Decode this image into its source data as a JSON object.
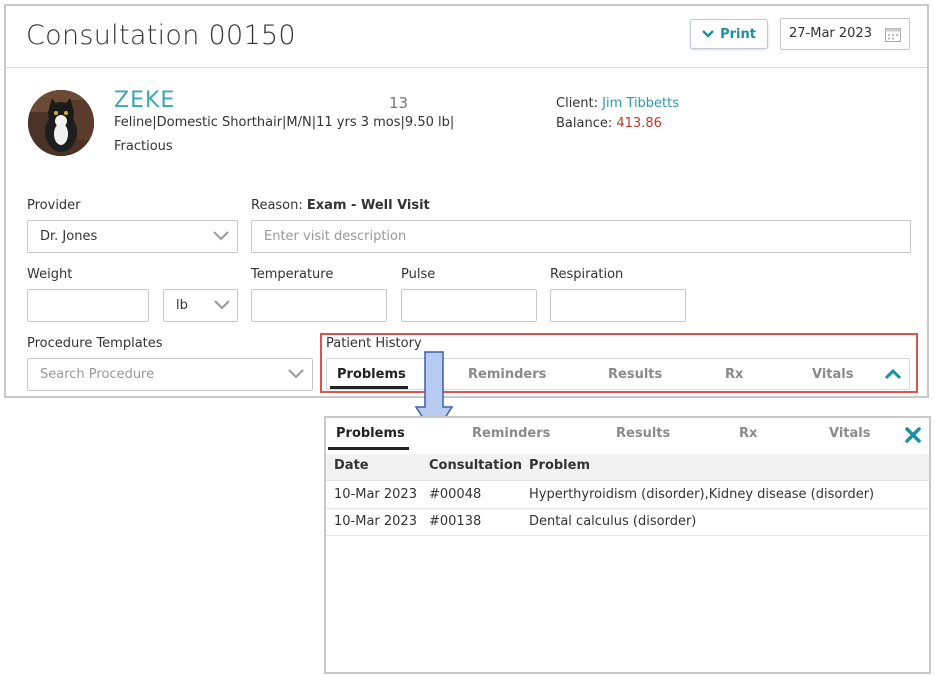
{
  "consultation": {
    "title": "Consultation 00150",
    "print_label": "Print",
    "date": "27-Mar 2023"
  },
  "patient": {
    "name": "ZEKE",
    "number": "13",
    "info": "Feline|Domestic Shorthair|M/N|11 yrs 3 mos|9.50 lb|",
    "tag": "Fractious",
    "client_label": "Client:",
    "client_name": "Jim Tibbetts",
    "balance_label": "Balance:",
    "balance_value": "413.86"
  },
  "form": {
    "provider_label": "Provider",
    "provider_value": "Dr. Jones",
    "reason_label": "Reason:",
    "reason_value": "Exam - Well Visit",
    "visit_placeholder": "Enter visit description",
    "weight_label": "Weight",
    "weight_unit": "lb",
    "temperature_label": "Temperature",
    "pulse_label": "Pulse",
    "respiration_label": "Respiration",
    "procedure_label": "Procedure Templates",
    "procedure_placeholder": "Search Procedure"
  },
  "history": {
    "label": "Patient History",
    "tabs": [
      "Problems",
      "Reminders",
      "Results",
      "Rx",
      "Vitals"
    ],
    "active_tab": "Problems"
  },
  "problems_table": {
    "columns": [
      "Date",
      "Consultation",
      "Problem"
    ],
    "rows": [
      {
        "date": "10-Mar 2023",
        "consultation": "#00048",
        "problem": "Hyperthyroidism (disorder),Kidney disease (disorder)"
      },
      {
        "date": "10-Mar 2023",
        "consultation": "#00138",
        "problem": "Dental calculus (disorder)"
      }
    ]
  },
  "colors": {
    "accent": "#2b9aab",
    "balance": "#c0392b",
    "highlight": "#d9534f",
    "arrow": "#b4c7ef"
  },
  "icons": {
    "print": "chevron-down-icon",
    "date": "calendar-icon",
    "collapse": "chevron-up-icon",
    "close": "close-icon"
  }
}
